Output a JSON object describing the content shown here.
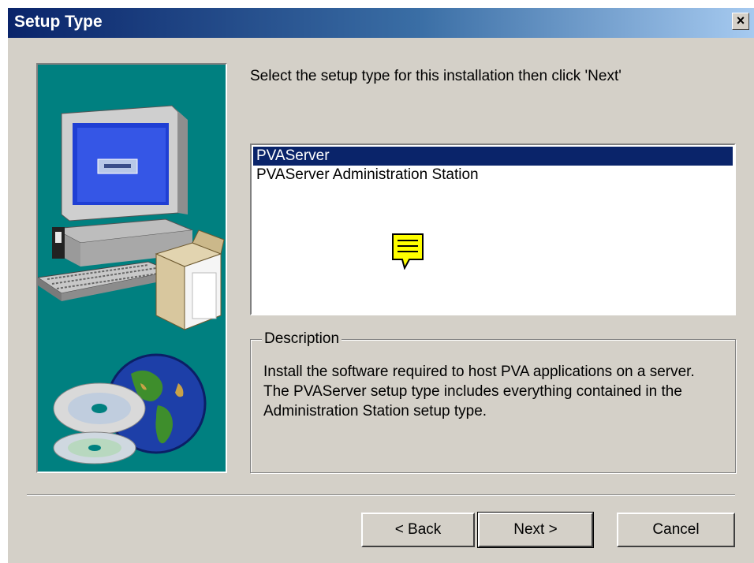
{
  "window": {
    "title": "Setup Type",
    "close_label": "×"
  },
  "main": {
    "prompt": "Select the setup type for this installation then click 'Next'",
    "setup_types": [
      {
        "label": "PVAServer",
        "selected": true
      },
      {
        "label": "PVAServer Administration Station",
        "selected": false
      }
    ],
    "description": {
      "label": "Description",
      "text": "Install the software required to host PVA applications on a server.  The PVAServer setup type includes everything contained in the Administration Station setup type."
    }
  },
  "buttons": {
    "back": "< Back",
    "next": "Next >",
    "cancel": "Cancel"
  },
  "colors": {
    "titlebar": "#0a246a",
    "dialog": "#d4d0c8",
    "art_bg": "#008080",
    "selection": "#0a246a",
    "note_icon": "#ffff00"
  },
  "icons": [
    "close-icon",
    "note-icon",
    "computer-illustration",
    "globe-cd-illustration"
  ]
}
